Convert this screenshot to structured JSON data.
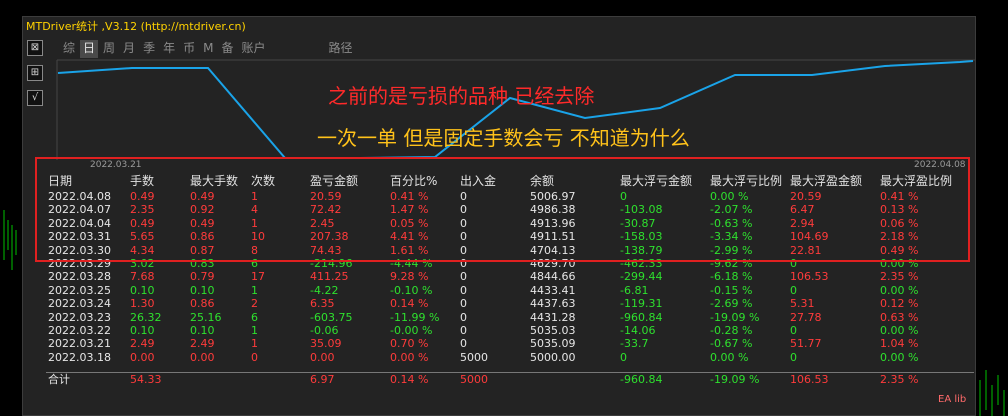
{
  "window": {
    "title": "MTDriver统计 ,V3.12 (http://mtdriver.cn)"
  },
  "side_icons": [
    "⊠",
    "⊞",
    "√"
  ],
  "tabs": [
    {
      "label": "综",
      "active": false
    },
    {
      "label": "日",
      "active": true
    },
    {
      "label": "周",
      "active": false
    },
    {
      "label": "月",
      "active": false
    },
    {
      "label": "季",
      "active": false
    },
    {
      "label": "年",
      "active": false
    },
    {
      "label": "币",
      "active": false
    },
    {
      "label": "M",
      "active": false
    },
    {
      "label": "备",
      "active": false
    },
    {
      "label": "账户",
      "active": false
    },
    {
      "label": "路径",
      "active": false
    }
  ],
  "annotations": {
    "red": "之前的是亏损的品种 已经去除",
    "yellow": "一次一单   但是固定手数会亏  不知道为什么"
  },
  "chart": {
    "date_start": "2022.03.21",
    "date_end": "2022.04.08",
    "line_color": "#1aa3e8"
  },
  "table": {
    "columns": [
      "日期",
      "手数",
      "最大手数",
      "次数",
      "盈亏金额",
      "百分比%",
      "出入金",
      "余额",
      "最大浮亏金额",
      "最大浮亏比例",
      "最大浮盈金额",
      "最大浮盈比例"
    ],
    "rows": [
      [
        "2022.04.08",
        "0.49",
        "0.49",
        "1",
        "20.59",
        "0.41 %",
        "0",
        "5006.97",
        "0",
        "0.00 %",
        "20.59",
        "0.41 %"
      ],
      [
        "2022.04.07",
        "2.35",
        "0.92",
        "4",
        "72.42",
        "1.47 %",
        "0",
        "4986.38",
        "-103.08",
        "-2.07 %",
        "6.47",
        "0.13 %"
      ],
      [
        "2022.04.04",
        "0.49",
        "0.49",
        "1",
        "2.45",
        "0.05 %",
        "0",
        "4913.96",
        "-30.87",
        "-0.63 %",
        "2.94",
        "0.06 %"
      ],
      [
        "2022.03.31",
        "5.65",
        "0.86",
        "10",
        "207.38",
        "4.41 %",
        "0",
        "4911.51",
        "-158.03",
        "-3.34 %",
        "104.69",
        "2.18 %"
      ],
      [
        "2022.03.30",
        "4.34",
        "0.87",
        "8",
        "74.43",
        "1.61 %",
        "0",
        "4704.13",
        "-138.79",
        "-2.99 %",
        "22.81",
        "0.49 %"
      ],
      [
        "2022.03.29",
        "3.02",
        "0.83",
        "6",
        "-214.96",
        "-4.44 %",
        "0",
        "4629.70",
        "-462.33",
        "-9.62 %",
        "0",
        "0.00 %"
      ],
      [
        "2022.03.28",
        "7.68",
        "0.79",
        "17",
        "411.25",
        "9.28 %",
        "0",
        "4844.66",
        "-299.44",
        "-6.18 %",
        "106.53",
        "2.35 %"
      ],
      [
        "2022.03.25",
        "0.10",
        "0.10",
        "1",
        "-4.22",
        "-0.10 %",
        "0",
        "4433.41",
        "-6.81",
        "-0.15 %",
        "0",
        "0.00 %"
      ],
      [
        "2022.03.24",
        "1.30",
        "0.86",
        "2",
        "6.35",
        "0.14 %",
        "0",
        "4437.63",
        "-119.31",
        "-2.69 %",
        "5.31",
        "0.12 %"
      ],
      [
        "2022.03.23",
        "26.32",
        "25.16",
        "6",
        "-603.75",
        "-11.99 %",
        "0",
        "4431.28",
        "-960.84",
        "-19.09 %",
        "27.78",
        "0.63 %"
      ],
      [
        "2022.03.22",
        "0.10",
        "0.10",
        "1",
        "-0.06",
        "-0.00 %",
        "0",
        "5035.03",
        "-14.06",
        "-0.28 %",
        "0",
        "0.00 %"
      ],
      [
        "2022.03.21",
        "2.49",
        "2.49",
        "1",
        "35.09",
        "0.70 %",
        "0",
        "5035.09",
        "-33.7",
        "-0.67 %",
        "51.77",
        "1.04 %"
      ],
      [
        "2022.03.18",
        "0.00",
        "0.00",
        "0",
        "0.00",
        "0.00 %",
        "5000",
        "5000.00",
        "0",
        "0.00 %",
        "0",
        "0.00 %"
      ]
    ],
    "total": [
      "合计",
      "54.33",
      "",
      "",
      "6.97",
      "0.14 %",
      "5000",
      "",
      "-960.84",
      "-19.09 %",
      "106.53",
      "2.35 %"
    ]
  },
  "colors": {
    "red": "#ff3b3b",
    "green": "#2ee02e",
    "white": "#e6e6e6",
    "accent_title": "#ffd200"
  },
  "watermark": "EA lib"
}
